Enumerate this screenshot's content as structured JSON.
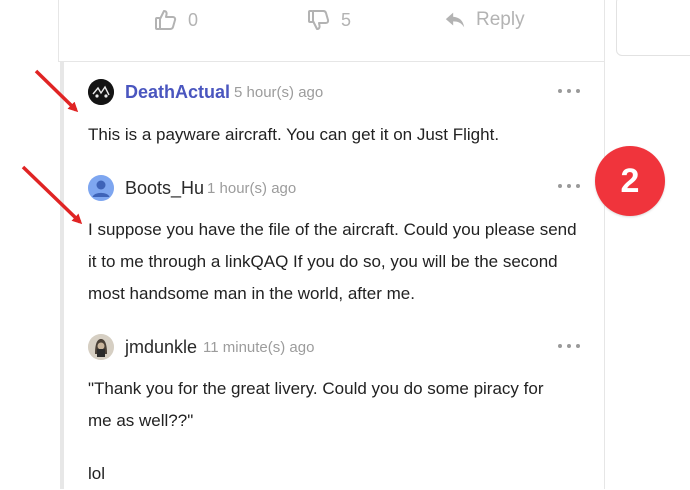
{
  "colors": {
    "author_link": "#4a56bf",
    "muted": "#9c9c9c",
    "action_gray": "#b3b3b3",
    "badge": "#f0343c",
    "arrow": "#e02424"
  },
  "post_actions": {
    "likes": "0",
    "dislikes": "5",
    "reply_label": "Reply"
  },
  "comments": [
    {
      "author": "DeathActual",
      "time": "5 hour(s) ago",
      "paragraphs": [
        "This is a payware aircraft. You can get it on Just Flight."
      ]
    },
    {
      "author": "Boots_Hu",
      "time": "1 hour(s) ago",
      "paragraphs": [
        "I suppose you have the file of the aircraft. Could you please send it to me through a linkQAQ If you do so, you will be the second most handsome man in the world, after me."
      ]
    },
    {
      "author": "jmdunkle",
      "time": "11 minute(s) ago",
      "paragraphs": [
        "\"Thank you for the great livery. Could you do some piracy for me as well??\"",
        "lol"
      ]
    }
  ],
  "annotation_badge": "2"
}
